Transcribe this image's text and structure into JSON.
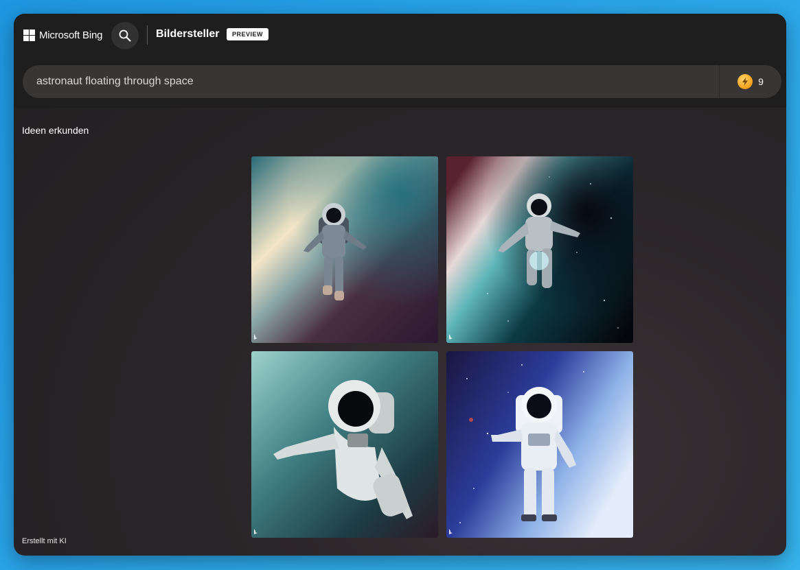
{
  "header": {
    "brand": "Microsoft Bing",
    "product_title": "Bildersteller",
    "badge": "PREVIEW"
  },
  "prompt": {
    "value": "astronaut floating through space"
  },
  "boosts": {
    "count": "9"
  },
  "explore": {
    "title": "Ideen erkunden"
  },
  "footer": {
    "note": "Erstellt mit KI"
  },
  "icons": {
    "search": "search-icon",
    "boost": "lightning-bolt-icon",
    "bing_mark": "bing-logo-icon"
  }
}
